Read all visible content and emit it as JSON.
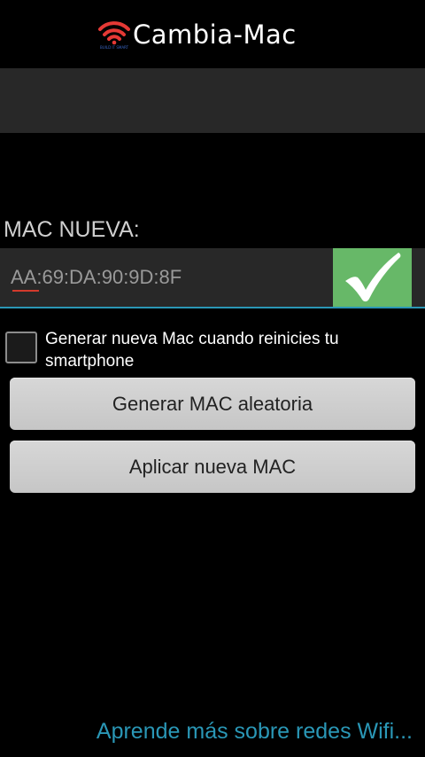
{
  "app": {
    "title": "Cambia-Mac",
    "logo_icon": "wifi-logo-icon",
    "logo_text": "BUILD IT SMART"
  },
  "mac": {
    "label": "MAC NUEVA:",
    "value": "AA:69:DA:90:9D:8F",
    "apply_icon": "checkmark-icon"
  },
  "options": {
    "regenerate_on_reboot_label": "Generar nueva Mac cuando reinicies tu smartphone",
    "regenerate_on_reboot_checked": false
  },
  "buttons": {
    "random_label": "Generar MAC aleatoria",
    "apply_label": "Aplicar nueva MAC"
  },
  "footer": {
    "learn_more_label": "Aprende más sobre redes Wifi..."
  },
  "colors": {
    "accent": "#2a97b6",
    "apply_green": "#67b868",
    "logo_red": "#e53935",
    "spell_error": "#d33a2c",
    "button_gray": "#cfcfcf",
    "background": "#000000",
    "panel": "#282828"
  }
}
